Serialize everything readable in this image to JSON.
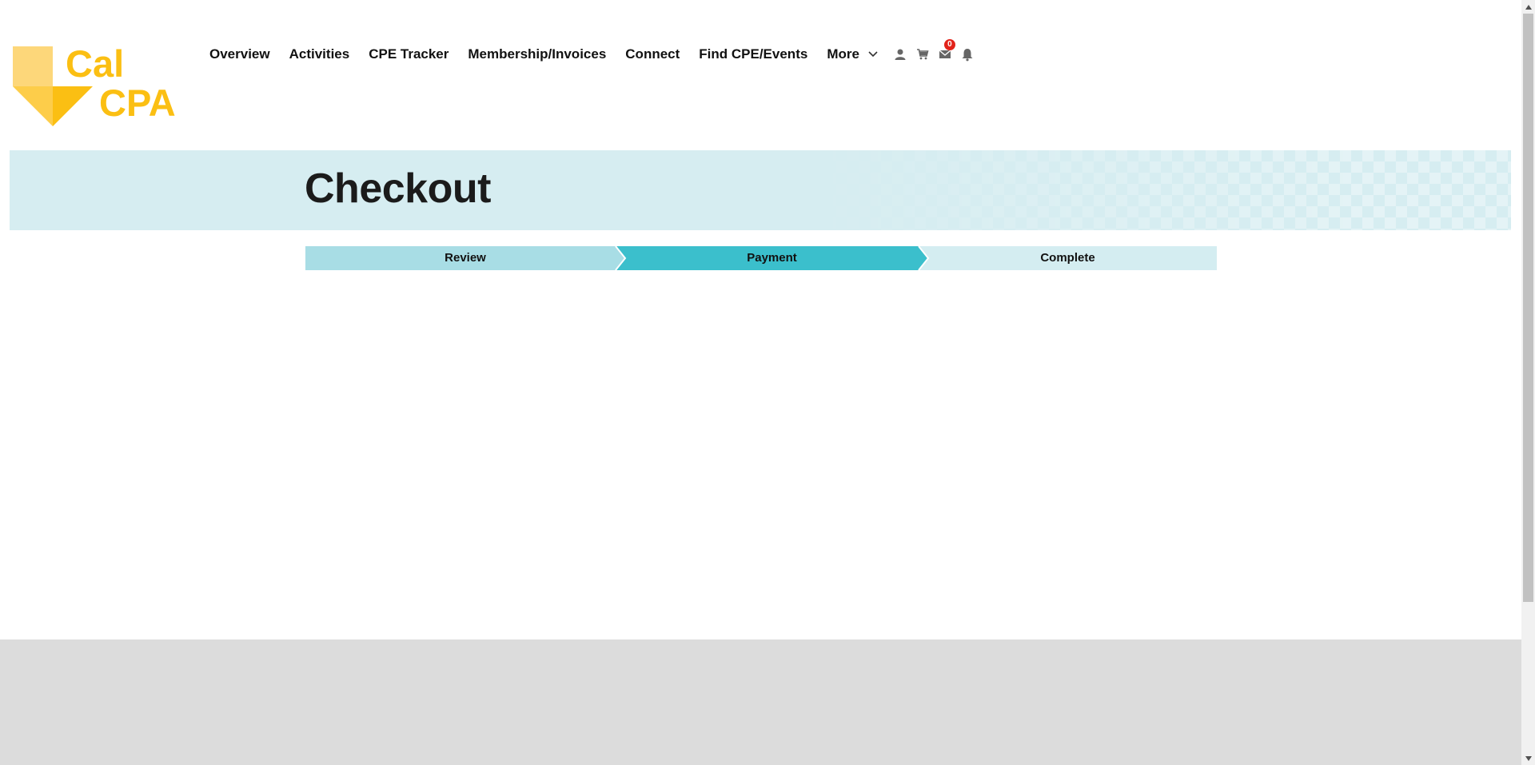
{
  "logo": {
    "line1": "Cal",
    "line2": "CPA",
    "color": "#fbbf13"
  },
  "nav": {
    "items": [
      {
        "label": "Overview"
      },
      {
        "label": "Activities"
      },
      {
        "label": "CPE Tracker"
      },
      {
        "label": "Membership/Invoices"
      },
      {
        "label": "Connect"
      },
      {
        "label": "Find CPE/Events"
      }
    ],
    "more_label": "More",
    "icons": [
      "user-icon",
      "cart-icon",
      "mail-icon",
      "bell-icon"
    ],
    "mail_badge": "0"
  },
  "banner": {
    "title": "Checkout",
    "background": "#d6edf1"
  },
  "steps": [
    {
      "label": "Review",
      "color": "#a8dde5"
    },
    {
      "label": "Payment",
      "color": "#3bbfcc",
      "active": true
    },
    {
      "label": "Complete",
      "color": "#d4edf1"
    }
  ],
  "footer": {
    "background": "#dcdcdc"
  }
}
